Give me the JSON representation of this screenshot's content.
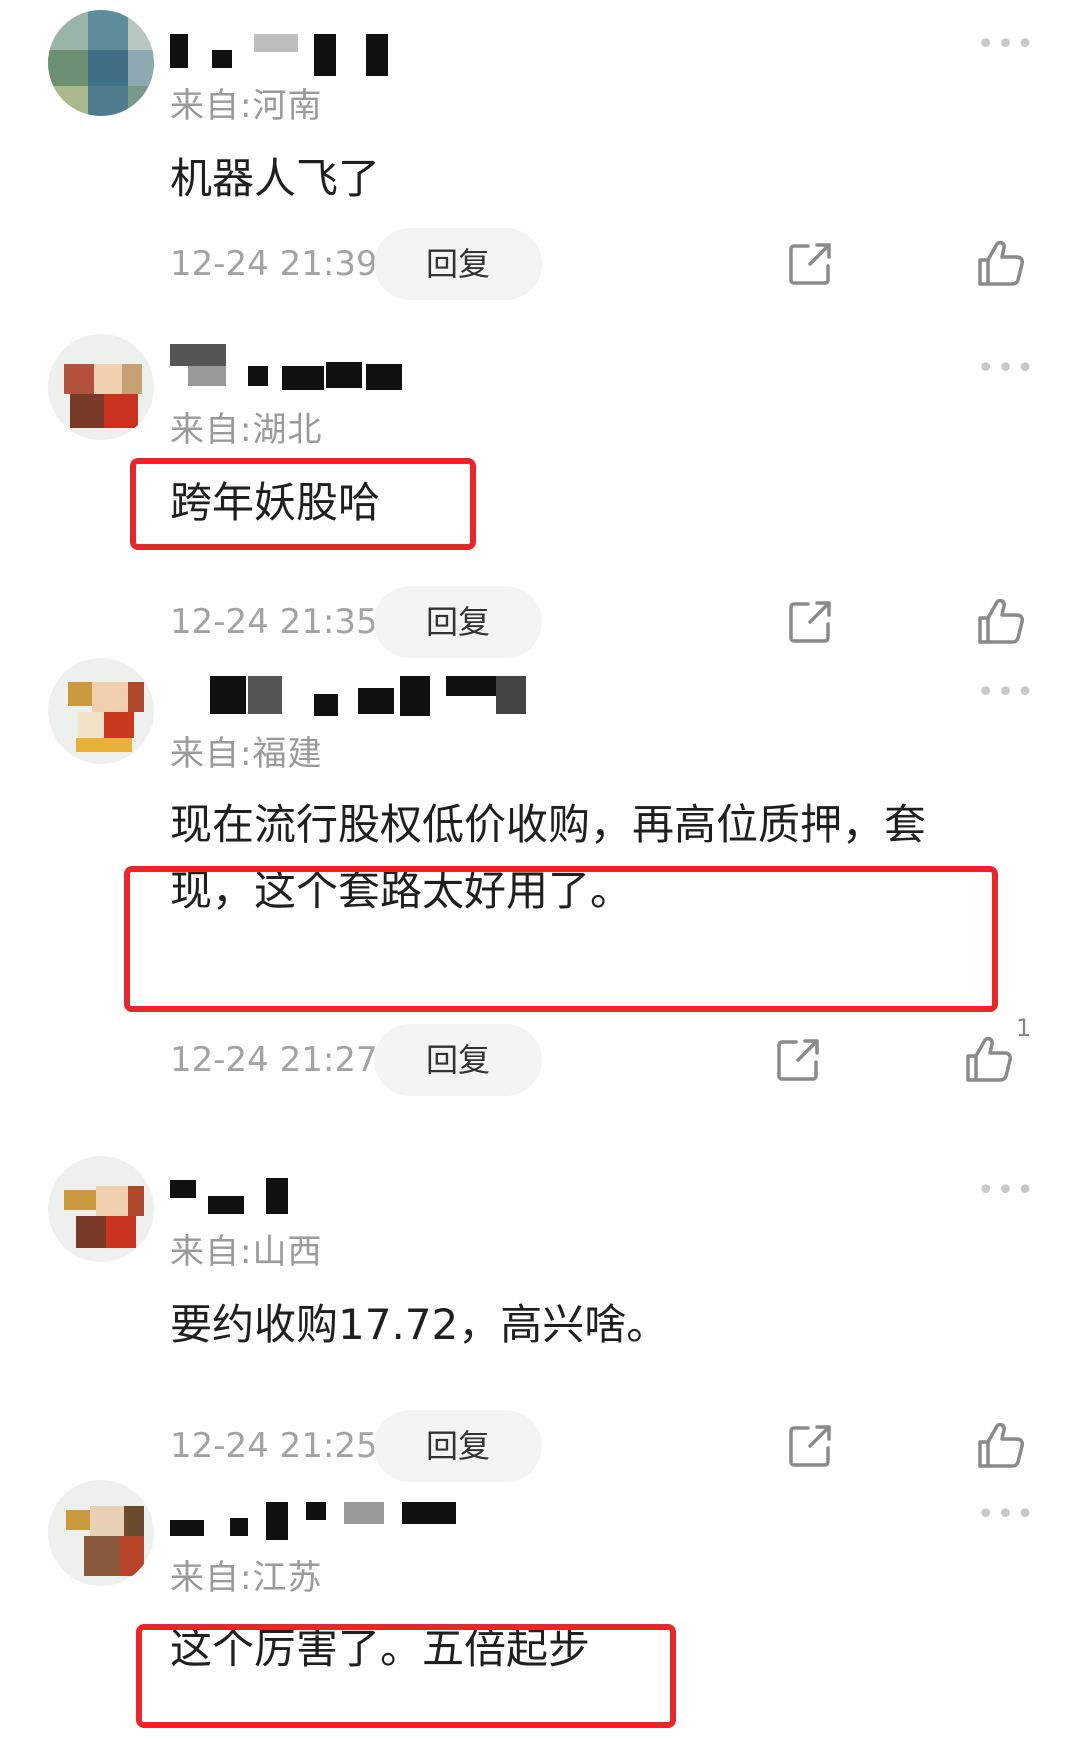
{
  "icons": {
    "more": "more-dots-icon",
    "share": "share-icon",
    "like": "thumbs-up-icon"
  },
  "colors": {
    "highlight": "#e8262b",
    "location_text": "#9a9a9a",
    "time_text": "#a3a3a3",
    "reply_bg": "#f4f4f4"
  },
  "comments": [
    {
      "username": "",
      "location": "来自:河南",
      "content": "机器人飞了",
      "time": "12-24 21:39",
      "reply_label": "回复",
      "more": "•••",
      "likes": "",
      "highlighted": false
    },
    {
      "username": "",
      "location": "来自:湖北",
      "content": "跨年妖股哈",
      "time": "12-24 21:35",
      "reply_label": "回复",
      "more": "•••",
      "likes": "",
      "highlighted": true
    },
    {
      "username": "",
      "location": "来自:福建",
      "content": "现在流行股权低价收购，再高位质押，套现，这个套路太好用了。",
      "time": "12-24 21:27",
      "reply_label": "回复",
      "more": "•••",
      "likes": "1",
      "highlighted": true
    },
    {
      "username": "",
      "location": "来自:山西",
      "content": "要约收购17.72，高兴啥。",
      "time": "12-24 21:25",
      "reply_label": "回复",
      "more": "•••",
      "likes": "",
      "highlighted": false
    },
    {
      "username": "",
      "location": "来自:江苏",
      "content": "这个厉害了。五倍起步",
      "time": "",
      "reply_label": "",
      "more": "•••",
      "likes": "",
      "highlighted": true
    }
  ]
}
